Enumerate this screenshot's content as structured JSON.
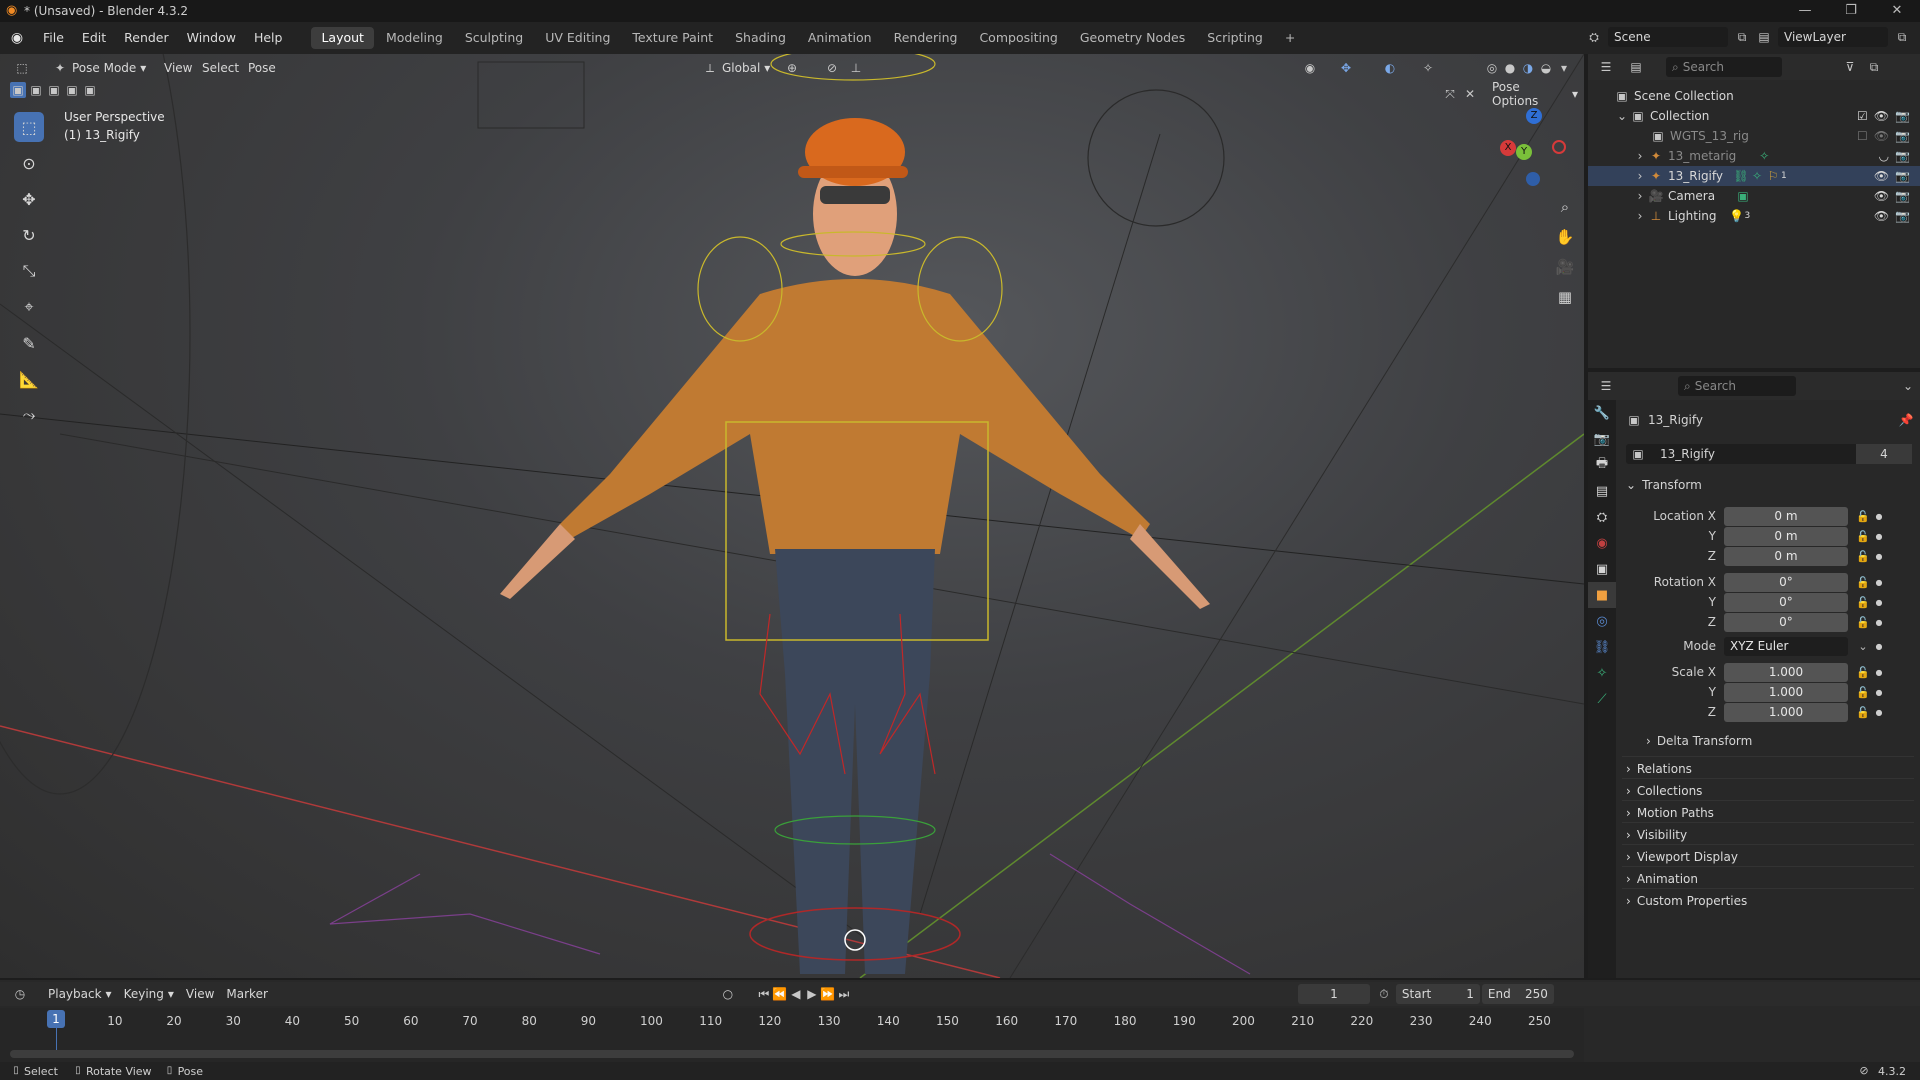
{
  "window": {
    "title": "* (Unsaved) - Blender 4.3.2",
    "controls": [
      "—",
      "❐",
      "✕"
    ]
  },
  "menubar": {
    "menus": [
      "File",
      "Edit",
      "Render",
      "Window",
      "Help"
    ],
    "workspaces": [
      "Layout",
      "Modeling",
      "Sculpting",
      "UV Editing",
      "Texture Paint",
      "Shading",
      "Animation",
      "Rendering",
      "Compositing",
      "Geometry Nodes",
      "Scripting"
    ],
    "add_tab": "+",
    "scene_label": "Scene",
    "viewlayer_label": "ViewLayer"
  },
  "viewport": {
    "mode": "Pose Mode",
    "menus": [
      "View",
      "Select",
      "Pose"
    ],
    "orientation": "Global",
    "pose_options": "Pose Options",
    "overlay_line1": "User Perspective",
    "overlay_line2": "(1) 13_Rigify",
    "gizmo": {
      "x": "X",
      "y": "Y",
      "z": "Z"
    }
  },
  "outliner": {
    "search_placeholder": "Search",
    "scene_collection": "Scene Collection",
    "collection": "Collection",
    "items": [
      "WGTS_13_rig",
      "13_metarig",
      "13_Rigify",
      "Camera",
      "Lighting"
    ],
    "lighting_count": "3",
    "rigify_count": "1"
  },
  "properties": {
    "search_placeholder": "Search",
    "object_name": "13_Rigify",
    "datablock_name": "13_Rigify",
    "users": "4",
    "transform_title": "Transform",
    "location": {
      "label": "Location X",
      "x": "0 m",
      "y": "0 m",
      "z": "0 m"
    },
    "rotation": {
      "label": "Rotation X",
      "x": "0°",
      "y": "0°",
      "z": "0°"
    },
    "mode_label": "Mode",
    "mode_value": "XYZ Euler",
    "scale": {
      "label": "Scale X",
      "x": "1.000",
      "y": "1.000",
      "z": "1.000"
    },
    "axis_y": "Y",
    "axis_z": "Z",
    "delta": "Delta Transform",
    "panels": [
      "Relations",
      "Collections",
      "Motion Paths",
      "Visibility",
      "Viewport Display",
      "Animation",
      "Custom Properties"
    ]
  },
  "timeline": {
    "menus": [
      "Playback",
      "Keying",
      "View",
      "Marker"
    ],
    "current_frame": "1",
    "start_label": "Start",
    "start_value": "1",
    "end_label": "End",
    "end_value": "250",
    "ruler": [
      "10",
      "20",
      "30",
      "40",
      "50",
      "60",
      "70",
      "80",
      "90",
      "100",
      "110",
      "120",
      "130",
      "140",
      "150",
      "160",
      "170",
      "180",
      "190",
      "200",
      "210",
      "220",
      "230",
      "240",
      "250"
    ],
    "playhead": "1"
  },
  "statusbar": {
    "hint1": "Select",
    "hint2": "Rotate View",
    "hint3": "Pose",
    "version": "4.3.2"
  }
}
